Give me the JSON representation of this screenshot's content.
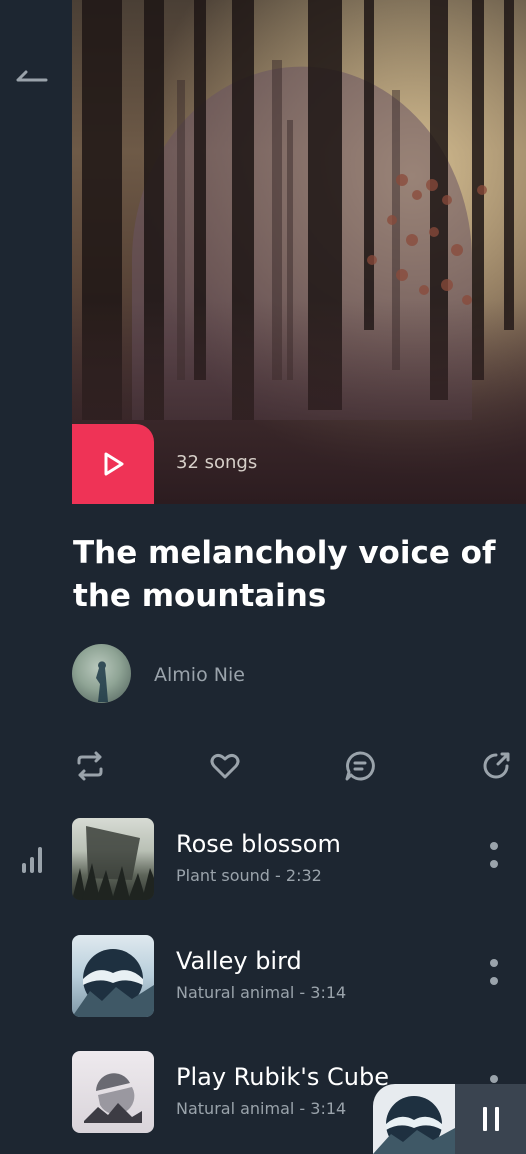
{
  "playlist": {
    "song_count": "32 songs",
    "title": "The melancholy voice of the mountains",
    "artist": "Almio Nie"
  },
  "icons": {
    "back": "back-arrow-icon",
    "play": "play-icon",
    "repeat": "repeat-icon",
    "like": "heart-icon",
    "comment": "comment-icon",
    "share": "share-icon",
    "now_playing": "equalizer-icon",
    "more": "more-vertical-icon",
    "pause": "pause-icon"
  },
  "tracks": [
    {
      "title": "Rose blossom",
      "subtitle": "Plant sound - 2:32"
    },
    {
      "title": "Valley bird",
      "subtitle": "Natural animal - 3:14"
    },
    {
      "title": "Play Rubik's Cube",
      "subtitle": "Natural animal - 3:14"
    }
  ],
  "colors": {
    "background": "#1d2631",
    "accent": "#ef3356",
    "muted_text": "#9aa3ab",
    "mini_player_bg": "#3a4450"
  }
}
